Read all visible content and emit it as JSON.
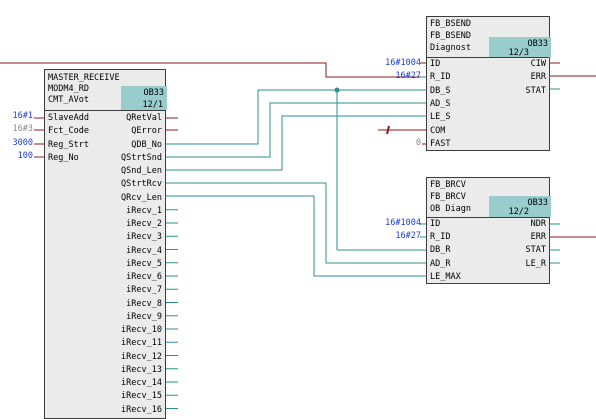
{
  "colors": {
    "wire_teal": "#2a8f8f",
    "wire_red": "#8b1a1a",
    "block_fill": "#ebebeb",
    "ob_fill": "#99cccc",
    "param_blue": "#1a3cdc"
  },
  "master": {
    "title1": "MASTER_RECEIVE",
    "title2": "MODM4_RD",
    "title3": "CMT_AVot",
    "ob": "OB33",
    "ob_num": "12/1",
    "in_pins": [
      "SlaveAdd",
      "Fct_Code",
      "Reg_Strt",
      "Reg_No"
    ],
    "in_values": [
      "16#1",
      "16#3",
      "3000",
      "100"
    ],
    "out_pins": [
      "QRetVal",
      "QError",
      "QDB_No",
      "QStrtSnd",
      "QSnd_Len",
      "QStrtRcv",
      "QRcv_Len",
      "iRecv_1",
      "iRecv_2",
      "iRecv_3",
      "iRecv_4",
      "iRecv_5",
      "iRecv_6",
      "iRecv_7",
      "iRecv_8",
      "iRecv_9",
      "iRecv_10",
      "iRecv_11",
      "iRecv_12",
      "iRecv_13",
      "iRecv_14",
      "iRecv_15",
      "iRecv_16"
    ]
  },
  "bsend": {
    "title1": "FB_BSEND",
    "title2": "FB_BSEND",
    "title3": "Diagnost",
    "ob": "OB33",
    "ob_num": "12/3",
    "in_pins": [
      "ID",
      "R_ID",
      "DB_S",
      "AD_S",
      "LE_S",
      "COM",
      "FAST"
    ],
    "in_values": [
      "16#1004",
      "16#27",
      "",
      "",
      "",
      "",
      "0"
    ],
    "out_pins": [
      "CIW",
      "ERR",
      "STAT"
    ]
  },
  "brcv": {
    "title1": "FB_BRCV",
    "title2": "FB_BRCV",
    "title3": "OB Diagn",
    "ob": "OB33",
    "ob_num": "12/2",
    "in_pins": [
      "ID",
      "R_ID",
      "DB_R",
      "AD_R",
      "LE_MAX"
    ],
    "in_values": [
      "16#1004",
      "16#27",
      "",
      "",
      ""
    ],
    "out_pins": [
      "NDR",
      "ERR",
      "STAT",
      "LE_R"
    ]
  }
}
